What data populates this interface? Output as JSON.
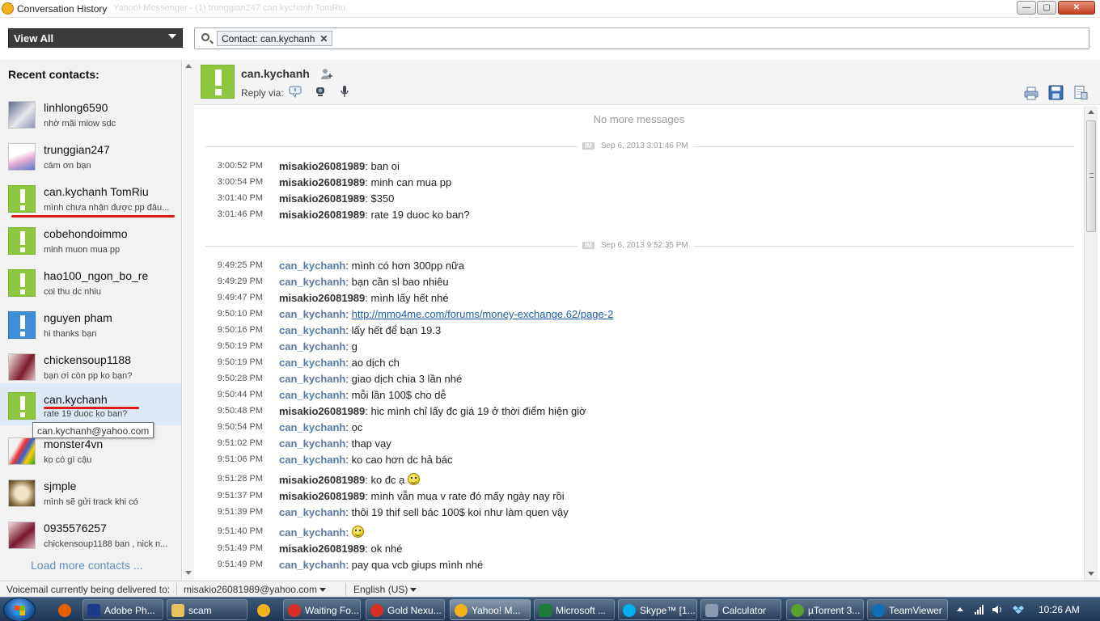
{
  "window": {
    "title": "Conversation History",
    "ghost_title": "Yahoo! Messenger - (1) trunggian247 can.kychanh TomRiu",
    "controls": {
      "minimize": "—",
      "maximize": "▢",
      "close": "✕"
    }
  },
  "toolbar": {
    "view_label": "View All",
    "search_chip": "Contact: can.kychanh",
    "chip_remove": "✕"
  },
  "sidebar": {
    "heading": "Recent contacts:",
    "contacts": [
      {
        "name": "linhlong6590",
        "last_message": "nhờ mãi miow sdc"
      },
      {
        "name": "trunggian247",
        "last_message": "cám ơn bạn"
      },
      {
        "name": "can.kychanh TomRiu",
        "last_message": "mình chưa nhận được pp đâu..."
      },
      {
        "name": "cobehondoimmo",
        "last_message": "minh muon mua pp"
      },
      {
        "name": "hao100_ngon_bo_re",
        "last_message": "coi thu dc nhiu"
      },
      {
        "name": "nguyen pham",
        "last_message": "hi thanks bạn"
      },
      {
        "name": "chickensoup1188",
        "last_message": "bạn ơi còn pp ko bạn?"
      },
      {
        "name": "can.kychanh",
        "last_message": "rate 19 duoc ko ban?"
      },
      {
        "name": "monster4vn",
        "last_message": "ko có gì cậu"
      },
      {
        "name": "sjmple",
        "last_message": "mình sẽ gửi track khi có"
      },
      {
        "name": "0935576257",
        "last_message": "chickensoup1188 ban , nick n..."
      }
    ],
    "tooltip": "can.kychanh@yahoo.com",
    "load_more": "Load more contacts ..."
  },
  "header": {
    "contact_name": "can.kychanh",
    "reply_via": "Reply via:"
  },
  "conversation": {
    "no_more": "No more messages",
    "sessions": [
      {
        "badge": "IM",
        "label": "Sep 6, 2013 3:01:46 PM",
        "messages": [
          {
            "time": "3:00:52 PM",
            "sender": "misakio26081989",
            "text": ": ban oi"
          },
          {
            "time": "3:00:54 PM",
            "sender": "misakio26081989",
            "text": ": minh can mua pp"
          },
          {
            "time": "3:01:40 PM",
            "sender": "misakio26081989",
            "text": ": $350"
          },
          {
            "time": "3:01:46 PM",
            "sender": "misakio26081989",
            "text": ": rate 19 duoc ko ban?"
          }
        ]
      },
      {
        "badge": "IM",
        "label": "Sep 6, 2013 9:52:35 PM",
        "messages": [
          {
            "time": "9:49:25 PM",
            "sender": "can_kychanh",
            "text": ": mình có hơn 300pp nữa"
          },
          {
            "time": "9:49:29 PM",
            "sender": "can_kychanh",
            "text": ": bạn cần sl bao nhiêu"
          },
          {
            "time": "9:49:47 PM",
            "sender": "misakio26081989",
            "text": ": mình lấy hết nhé"
          },
          {
            "time": "9:50:10 PM",
            "sender": "can_kychanh",
            "text": ": ",
            "link": "http://mmo4me.com/forums/money-exchange.62/page-2"
          },
          {
            "time": "9:50:16 PM",
            "sender": "can_kychanh",
            "text": ": lấy hết để bạn 19.3"
          },
          {
            "time": "9:50:19 PM",
            "sender": "can_kychanh",
            "text": ": g"
          },
          {
            "time": "9:50:19 PM",
            "sender": "can_kychanh",
            "text": ": ao dịch ch"
          },
          {
            "time": "9:50:28 PM",
            "sender": "can_kychanh",
            "text": ": giao dịch chia 3 lần nhé"
          },
          {
            "time": "9:50:44 PM",
            "sender": "can_kychanh",
            "text": ": mỗi lần 100$ cho dễ"
          },
          {
            "time": "9:50:48 PM",
            "sender": "misakio26081989",
            "text": ": hic mình chỉ lấy đc giá 19 ở thời điểm hiện giờ"
          },
          {
            "time": "9:50:54 PM",
            "sender": "can_kychanh",
            "text": ": ọc"
          },
          {
            "time": "9:51:02 PM",
            "sender": "can_kychanh",
            "text": ": thap vạy"
          },
          {
            "time": "9:51:06 PM",
            "sender": "can_kychanh",
            "text": ": ko cao hơn dc hả bác"
          },
          {
            "time": "9:51:28 PM",
            "sender": "misakio26081989",
            "text": ": ko đc ạ ",
            "emoji": "smile-emoticon"
          },
          {
            "time": "9:51:37 PM",
            "sender": "misakio26081989",
            "text": ": mình vẫn mua v rate đó mấy ngày nay rồi"
          },
          {
            "time": "9:51:39 PM",
            "sender": "can_kychanh",
            "text": ": thôi 19 thif sell bác 100$ koi như làm quen vậy"
          },
          {
            "time": "9:51:40 PM",
            "sender": "can_kychanh",
            "text": ": ",
            "emoji": "smile-emoticon"
          },
          {
            "time": "9:51:49 PM",
            "sender": "misakio26081989",
            "text": ": ok nhé"
          },
          {
            "time": "9:51:49 PM",
            "sender": "can_kychanh",
            "text": ": pay qua vcb giups mình nhé"
          }
        ]
      }
    ]
  },
  "statusbar": {
    "voicemail_label": "Voicemail currently being delivered to:",
    "voicemail_target": "misakio26081989@yahoo.com",
    "language": "English (US)"
  },
  "taskbar": {
    "items": [
      {
        "label": "",
        "icon": "firefox-icon",
        "color": "#e66000"
      },
      {
        "label": "Adobe Ph...",
        "icon": "photoshop-icon",
        "color": "#1c3a8a"
      },
      {
        "label": "scam",
        "icon": "folder-icon",
        "color": "#e8c25a"
      },
      {
        "label": "",
        "icon": "yahoo-messenger-icon",
        "color": "#f6b21a"
      },
      {
        "label": "Waiting Fo...",
        "icon": "chrome-icon",
        "color": "#d93025"
      },
      {
        "label": "Gold Nexu...",
        "icon": "chrome-icon",
        "color": "#d93025"
      },
      {
        "label": "Yahoo! M...",
        "icon": "yahoo-messenger-icon",
        "color": "#f6b21a"
      },
      {
        "label": "Microsoft ...",
        "icon": "excel-icon",
        "color": "#1f7a3a"
      },
      {
        "label": "Skype™ [1...",
        "icon": "skype-icon",
        "color": "#00aff0"
      },
      {
        "label": "Calculator",
        "icon": "calculator-icon",
        "color": "#8a9bb0"
      },
      {
        "label": "µTorrent 3...",
        "icon": "utorrent-icon",
        "color": "#5aa02c"
      },
      {
        "label": "TeamViewer",
        "icon": "teamviewer-icon",
        "color": "#0e6eb8"
      }
    ],
    "clock": "10:26 AM"
  }
}
